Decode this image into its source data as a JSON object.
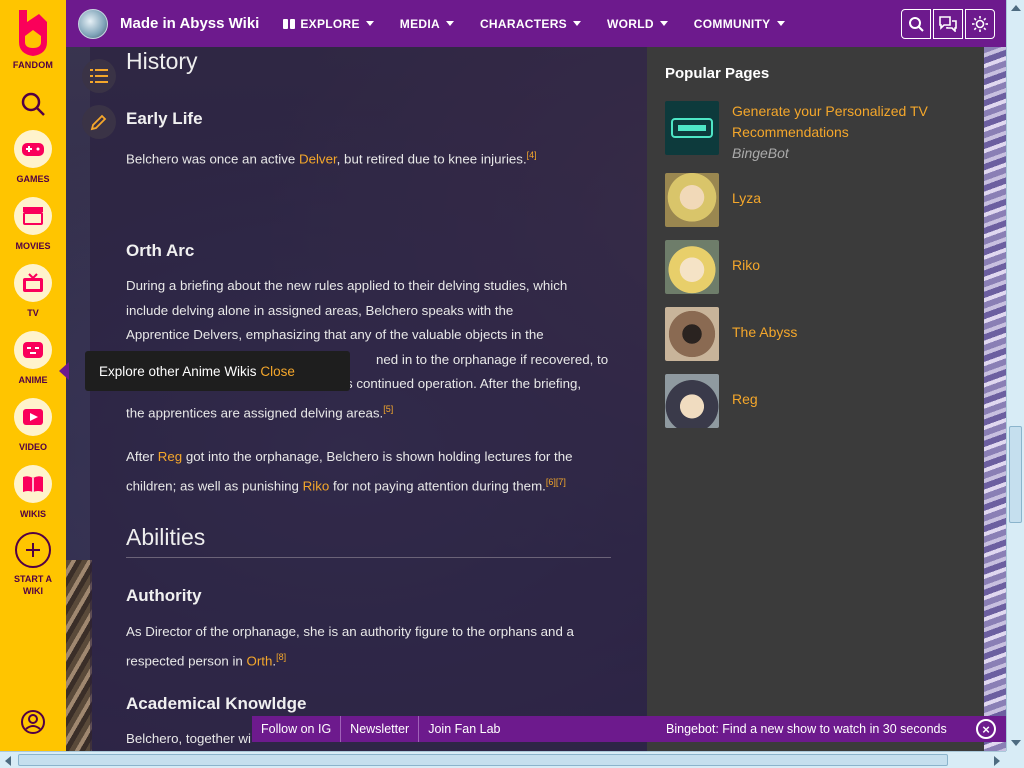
{
  "rail": {
    "brand": "FANDOM",
    "items": [
      {
        "label": "GAMES",
        "icon": "gamepad-icon"
      },
      {
        "label": "MOVIES",
        "icon": "clapperboard-icon"
      },
      {
        "label": "TV",
        "icon": "tv-icon"
      },
      {
        "label": "ANIME",
        "icon": "anime-face-icon"
      },
      {
        "label": "VIDEO",
        "icon": "play-icon"
      },
      {
        "label": "WIKIS",
        "icon": "book-icon"
      }
    ],
    "start_wiki_line1": "START A",
    "start_wiki_line2": "WIKI"
  },
  "header": {
    "wiki_name": "Made in Abyss Wiki",
    "nav": [
      {
        "label": "EXPLORE"
      },
      {
        "label": "MEDIA"
      },
      {
        "label": "CHARACTERS"
      },
      {
        "label": "WORLD"
      },
      {
        "label": "COMMUNITY"
      }
    ]
  },
  "article": {
    "history_heading": "History",
    "early_life_heading": "Early Life",
    "early_life_p1": "Belchero was once an active ",
    "early_life_link": "Delver",
    "early_life_p2": ", but retired due to knee injuries.",
    "early_life_ref": "[4]",
    "orth_heading": "Orth Arc",
    "orth_p1_l1": "During a briefing about the new rules applied to their delving studies, which",
    "orth_p1_l2": "include delving alone in assigned areas, Belchero speaks with the",
    "orth_p1_l3": "Apprentice Delvers, emphasizing that any of the valuable objects in the",
    "orth_p1_l4": "ned in to the orphanage if recovered, to",
    "orth_p1_l5": "s continued operation. After the briefing,",
    "orth_p1_l6": "the apprentices are assigned delving areas.",
    "orth_p1_ref": "[5]",
    "orth_p2_a": "After ",
    "orth_p2_link1": "Reg",
    "orth_p2_b": " got into the orphanage, Belchero is shown holding lectures for the",
    "orth_p2_c": "children; as well as punishing ",
    "orth_p2_link2": "Riko",
    "orth_p2_d": " for not paying attention during them.",
    "orth_p2_ref1": "[6]",
    "orth_p2_ref2": "[7]",
    "abilities_heading": "Abilities",
    "authority_heading": "Authority",
    "authority_p1": "As Director of the orphanage, she is an authority figure to the orphans and a",
    "authority_p2": "respected person in ",
    "authority_link": "Orth",
    "authority_ref": "[8]",
    "academic_heading": "Academical Knowldge",
    "academic_p1": "Belchero, together wi"
  },
  "popular": {
    "title": "Popular Pages",
    "items": [
      {
        "title_l1": "Generate your Personalized TV",
        "title_l2": "Recommendations",
        "sub": "BingeBot"
      },
      {
        "title": "Lyza"
      },
      {
        "title": "Riko"
      },
      {
        "title": "The Abyss"
      },
      {
        "title": "Reg"
      }
    ]
  },
  "tooltip": {
    "text": "Explore other Anime Wikis ",
    "close": "Close"
  },
  "bottom_bar": {
    "links": [
      "Follow on IG",
      "Newsletter",
      "Join Fan Lab"
    ],
    "bingebot": "Bingebot: Find a new show to watch in 30 seconds",
    "close_symbol": "×"
  },
  "colors": {
    "rail": "#ffc500",
    "nav": "#6d1a8d",
    "link": "#f4a72b"
  }
}
